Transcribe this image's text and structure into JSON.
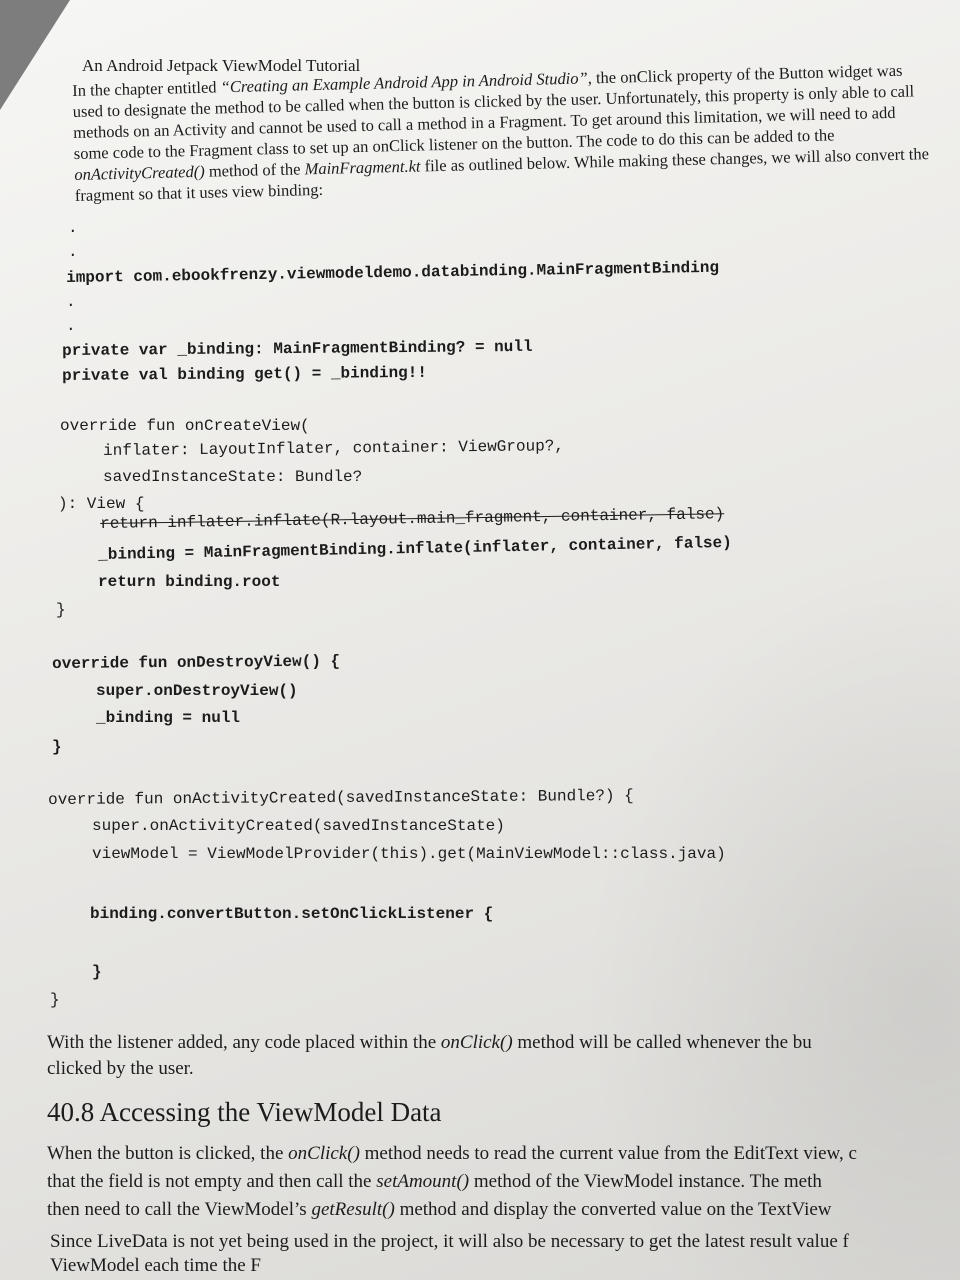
{
  "running_head": "An Android Jetpack ViewModel Tutorial",
  "intro": {
    "p1": "In the chapter entitled ",
    "chapter_ref": "“Creating an Example Android App in Android Studio”",
    "p2": ", the onClick property of the Button widget was used to designate the method to be called when the button is clicked by the user. Unfortunately, this property is only able to call methods on an Activity and cannot be used to call a method in a Fragment. To get around this limitation, we will need to add some code to the Fragment class to set up an onClick listener on the button. The code to do this can be added to the ",
    "method_ref": "onActivityCreated()",
    "p3": " method of the ",
    "file_ref": "MainFragment.kt",
    "p4": " file as outlined below. While making these changes, we will also convert the fragment so that it uses view binding:"
  },
  "code": {
    "dot1": ".",
    "dot2": ".",
    "import_line": "import com.ebookfrenzy.viewmodeldemo.databinding.MainFragmentBinding",
    "dot3": ".",
    "dot4": ".",
    "binding_var": "private var _binding: MainFragmentBinding? = null",
    "binding_val": "private val binding get() = _binding!!",
    "oncreate_sig": "override fun onCreateView(",
    "oncreate_arg1": "inflater: LayoutInflater, container: ViewGroup?,",
    "oncreate_arg2": "savedInstanceState: Bundle?",
    "oncreate_ret": "): View {",
    "oncreate_removed": "return inflater.inflate(R.layout.main_fragment, container, false)",
    "oncreate_inflate": "_binding = MainFragmentBinding.inflate(inflater, container, false)",
    "oncreate_return": "return binding.root",
    "close1": "}",
    "ondestroy_sig": "override fun onDestroyView() {",
    "ondestroy_super": "super.onDestroyView()",
    "ondestroy_null": "_binding = null",
    "close2": "}",
    "onactivity_sig": "override fun onActivityCreated(savedInstanceState: Bundle?) {",
    "onactivity_super": "super.onActivityCreated(savedInstanceState)",
    "onactivity_vm": "viewModel = ViewModelProvider(this).get(MainViewModel::class.java)",
    "listener": "binding.convertButton.setOnClickListener {",
    "listener_close": "}",
    "close3": "}"
  },
  "after_code": {
    "p1": "With the listener added, any code placed within the ",
    "onclick_ref": "onClick()",
    "p2": " method will be called whenever the bu",
    "p3": "clicked by the user."
  },
  "section": {
    "title": "40.8 Accessing the ViewModel Data",
    "p1": "When the button is clicked, the ",
    "onclick_ref": "onClick()",
    "p2": " method needs to read the current value from the EditText view, c",
    "p3": "that the field is not empty and then call the ",
    "setamount_ref": "setAmount()",
    "p4": " method of the ViewModel instance. The meth",
    "p5": "then need to call the ViewModel’s ",
    "getresult_ref": "getResult()",
    "p6": " method and display the converted value on the TextView",
    "p7": "Since LiveData is not yet being used in the project, it will also be necessary to get the latest result value f",
    "p8": "ViewModel each time the F"
  }
}
